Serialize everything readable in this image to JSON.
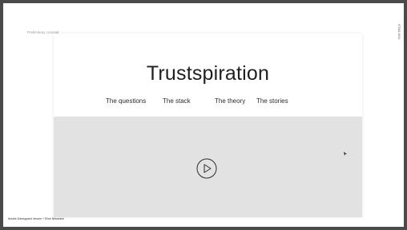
{
  "slide": {
    "corner_label": "Preliminary concept",
    "side_label": "ICTM2 2021",
    "authors": "Amalie Damsgaard Jensen + Eline Nilsonsen"
  },
  "page": {
    "title": "Trustspiration",
    "nav": [
      {
        "label": "The questions"
      },
      {
        "label": "The stack"
      },
      {
        "label": "The theory"
      },
      {
        "label": "The stories"
      }
    ]
  },
  "video": {
    "play_icon": "play-circle-icon",
    "background_color": "#e2e2e2"
  },
  "colors": {
    "frame": "#4a4a4a",
    "card": "#ffffff",
    "text": "#1f1f1f"
  }
}
